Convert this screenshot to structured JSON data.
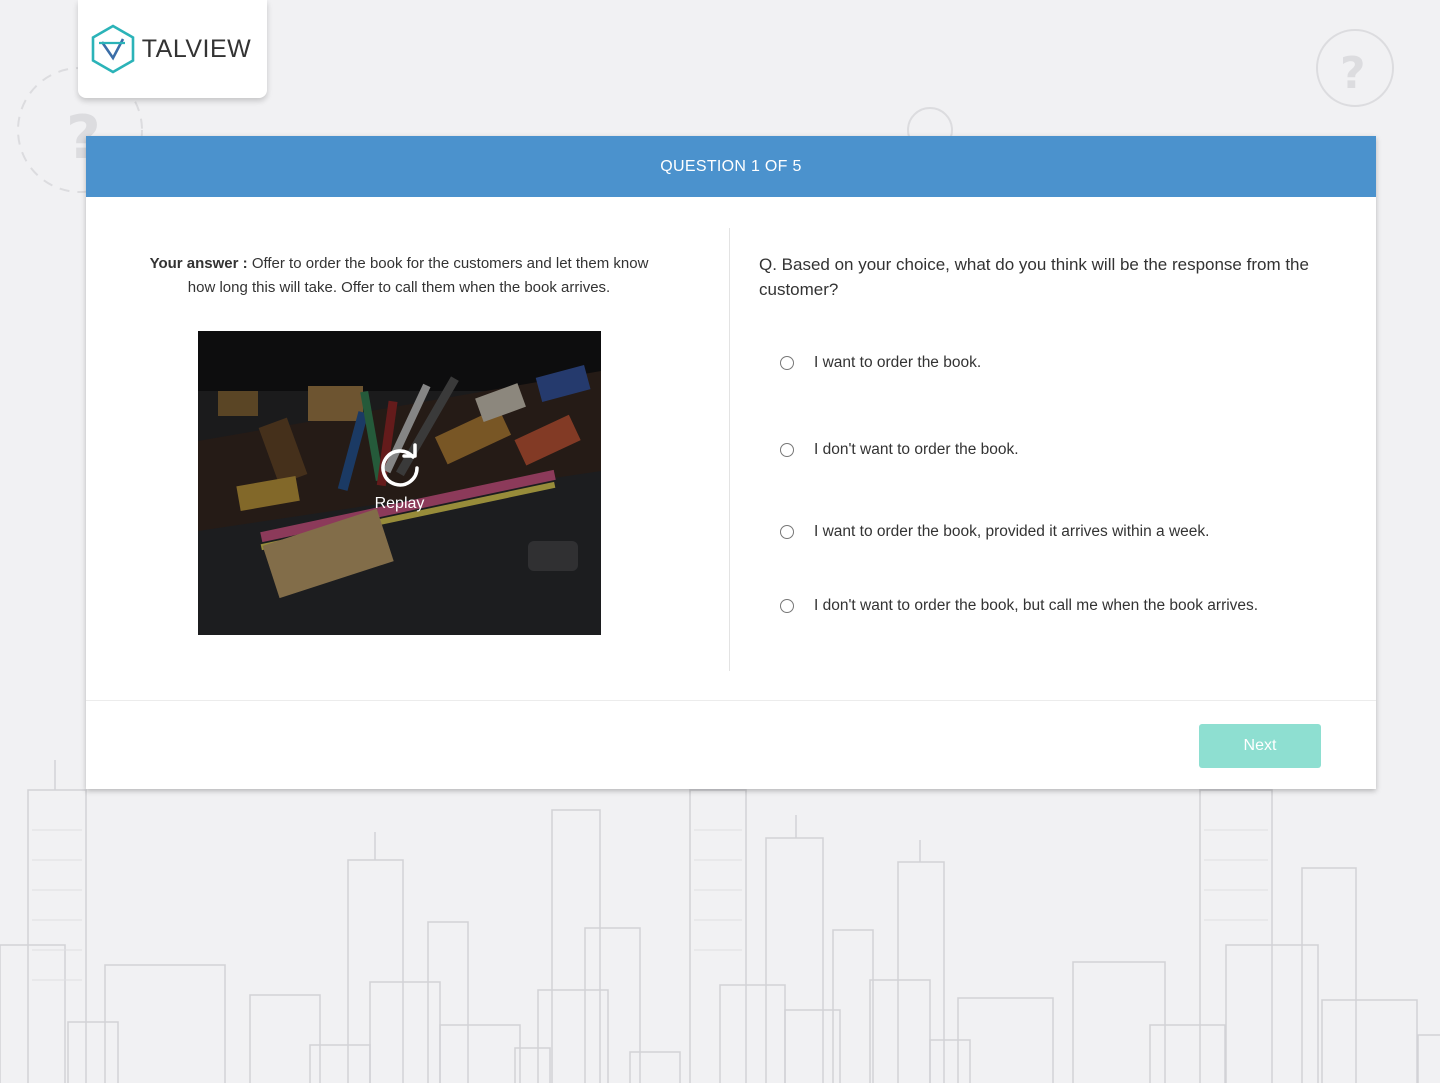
{
  "brand": {
    "name": "TALVIEW"
  },
  "header": {
    "title": "QUESTION 1 OF 5"
  },
  "answer": {
    "label": "Your answer :",
    "text": " Offer to order the book for the customers and let them know how long this will take. Offer to call them when the book arrives."
  },
  "video": {
    "replay_label": "Replay"
  },
  "question": {
    "text": "Q. Based on your choice, what do you think will be the response from the customer?",
    "options": [
      {
        "label": "I want to order the book."
      },
      {
        "label": "I don't want to order the book."
      },
      {
        "label": "I want to order the book, provided it arrives within a week."
      },
      {
        "label": "I don't want to order the book, but call me when the book arrives."
      }
    ]
  },
  "footer": {
    "next_label": "Next"
  },
  "colors": {
    "header_bg": "#4b92cd",
    "next_button": "#8edfd1",
    "logo_teal": "#2bb3b8",
    "logo_blue": "#3b6ea8"
  }
}
